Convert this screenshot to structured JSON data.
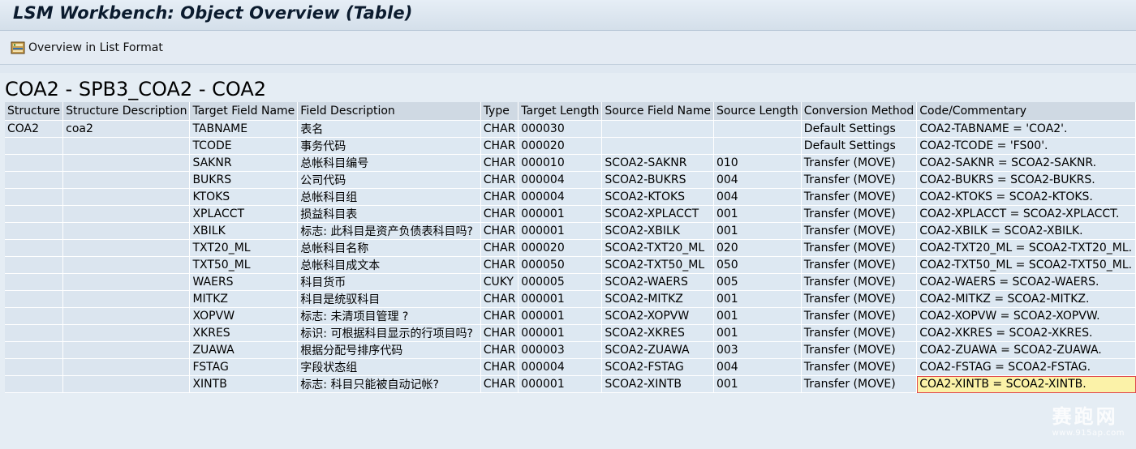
{
  "window": {
    "title": "LSM Workbench: Object Overview (Table)"
  },
  "toolbar": {
    "overview_list_label": "Overview in List Format",
    "overview_list_icon": "list-overview-icon"
  },
  "list": {
    "title": "COA2 - SPB3_COA2 - COA2"
  },
  "table": {
    "headers": [
      "Structure",
      "Structure Description",
      "Target Field Name",
      "Field Description",
      "Type",
      "Target Length",
      "Source Field Name",
      "Source Length",
      "Conversion Method",
      "Code/Commentary"
    ],
    "rows": [
      [
        "COA2",
        "coa2",
        "TABNAME",
        "表名",
        "CHAR",
        "000030",
        "",
        "",
        "Default Settings",
        "COA2-TABNAME = 'COA2'."
      ],
      [
        "",
        "",
        "TCODE",
        "事务代码",
        "CHAR",
        "000020",
        "",
        "",
        "Default Settings",
        "COA2-TCODE = 'FS00'."
      ],
      [
        "",
        "",
        "SAKNR",
        "总帐科目编号",
        "CHAR",
        "000010",
        "SCOA2-SAKNR",
        "010",
        "Transfer (MOVE)",
        "COA2-SAKNR = SCOA2-SAKNR."
      ],
      [
        "",
        "",
        "BUKRS",
        "公司代码",
        "CHAR",
        "000004",
        "SCOA2-BUKRS",
        "004",
        "Transfer (MOVE)",
        "COA2-BUKRS = SCOA2-BUKRS."
      ],
      [
        "",
        "",
        "KTOKS",
        "总帐科目组",
        "CHAR",
        "000004",
        "SCOA2-KTOKS",
        "004",
        "Transfer (MOVE)",
        "COA2-KTOKS = SCOA2-KTOKS."
      ],
      [
        "",
        "",
        "XPLACCT",
        "损益科目表",
        "CHAR",
        "000001",
        "SCOA2-XPLACCT",
        "001",
        "Transfer (MOVE)",
        "COA2-XPLACCT = SCOA2-XPLACCT."
      ],
      [
        "",
        "",
        "XBILK",
        "标志: 此科目是资产负债表科目吗?",
        "CHAR",
        "000001",
        "SCOA2-XBILK",
        "001",
        "Transfer (MOVE)",
        "COA2-XBILK = SCOA2-XBILK."
      ],
      [
        "",
        "",
        "TXT20_ML",
        "总帐科目名称",
        "CHAR",
        "000020",
        "SCOA2-TXT20_ML",
        "020",
        "Transfer (MOVE)",
        "COA2-TXT20_ML = SCOA2-TXT20_ML."
      ],
      [
        "",
        "",
        "TXT50_ML",
        "总帐科目成文本",
        "CHAR",
        "000050",
        "SCOA2-TXT50_ML",
        "050",
        "Transfer (MOVE)",
        "COA2-TXT50_ML = SCOA2-TXT50_ML."
      ],
      [
        "",
        "",
        "WAERS",
        "科目货币",
        "CUKY",
        "000005",
        "SCOA2-WAERS",
        "005",
        "Transfer (MOVE)",
        "COA2-WAERS = SCOA2-WAERS."
      ],
      [
        "",
        "",
        "MITKZ",
        "科目是统驭科目",
        "CHAR",
        "000001",
        "SCOA2-MITKZ",
        "001",
        "Transfer (MOVE)",
        "COA2-MITKZ = SCOA2-MITKZ."
      ],
      [
        "",
        "",
        "XOPVW",
        "标志: 未清项目管理 ?",
        "CHAR",
        "000001",
        "SCOA2-XOPVW",
        "001",
        "Transfer (MOVE)",
        "COA2-XOPVW = SCOA2-XOPVW."
      ],
      [
        "",
        "",
        "XKRES",
        "标识: 可根据科目显示的行项目吗?",
        "CHAR",
        "000001",
        "SCOA2-XKRES",
        "001",
        "Transfer (MOVE)",
        "COA2-XKRES = SCOA2-XKRES."
      ],
      [
        "",
        "",
        "ZUAWA",
        "根据分配号排序代码",
        "CHAR",
        "000003",
        "SCOA2-ZUAWA",
        "003",
        "Transfer (MOVE)",
        "COA2-ZUAWA = SCOA2-ZUAWA."
      ],
      [
        "",
        "",
        "FSTAG",
        "字段状态组",
        "CHAR",
        "000004",
        "SCOA2-FSTAG",
        "004",
        "Transfer (MOVE)",
        "COA2-FSTAG = SCOA2-FSTAG."
      ],
      [
        "",
        "",
        "XINTB",
        "标志: 科目只能被自动记帐?",
        "CHAR",
        "000001",
        "SCOA2-XINTB",
        "001",
        "Transfer (MOVE)",
        "COA2-XINTB = SCOA2-XINTB."
      ]
    ],
    "selected_row": 15
  },
  "watermark": {
    "text": "赛跑网",
    "sub": "www.915ap.com"
  }
}
